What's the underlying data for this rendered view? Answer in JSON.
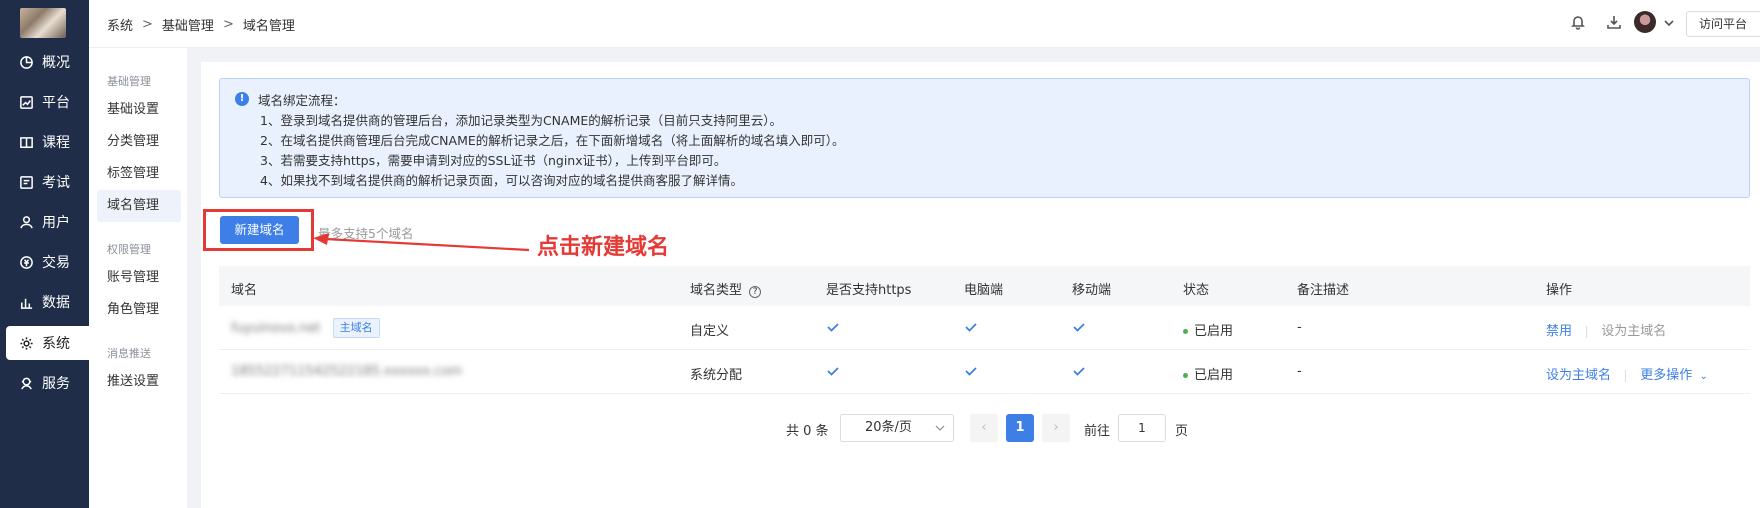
{
  "sidebar": {
    "items": [
      {
        "label": "概况",
        "icon": "overview-icon"
      },
      {
        "label": "平台",
        "icon": "platform-icon"
      },
      {
        "label": "课程",
        "icon": "course-icon"
      },
      {
        "label": "考试",
        "icon": "exam-icon"
      },
      {
        "label": "用户",
        "icon": "user-icon"
      },
      {
        "label": "交易",
        "icon": "trade-icon"
      },
      {
        "label": "数据",
        "icon": "data-icon"
      },
      {
        "label": "系统",
        "icon": "system-icon"
      },
      {
        "label": "服务",
        "icon": "service-icon"
      }
    ],
    "active": "系统"
  },
  "subnav": {
    "groups": [
      {
        "title": "基础管理",
        "items": [
          "基础设置",
          "分类管理",
          "标签管理",
          "域名管理"
        ]
      },
      {
        "title": "权限管理",
        "items": [
          "账号管理",
          "角色管理"
        ]
      },
      {
        "title": "消息推送",
        "items": [
          "推送设置"
        ]
      }
    ],
    "active": "域名管理"
  },
  "breadcrumb": [
    "系统",
    "基础管理",
    "域名管理"
  ],
  "header": {
    "visit_button": "访问平台"
  },
  "alert": {
    "title": "域名绑定流程：",
    "lines": [
      "1、登录到域名提供商的管理后台，添加记录类型为CNAME的解析记录（目前只支持阿里云）。",
      "2、在域名提供商管理后台完成CNAME的解析记录之后，在下面新增域名（将上面解析的域名填入即可）。",
      "3、若需要支持https，需要申请到对应的SSL证书（nginx证书），上传到平台即可。",
      "4、如果找不到域名提供商的解析记录页面，可以咨询对应的域名提供商客服了解详情。"
    ]
  },
  "toolbar": {
    "new_button": "新建域名",
    "limit_text": "最多支持5个域名",
    "annotation": "点击新建域名"
  },
  "table": {
    "columns": [
      "域名",
      "域名类型",
      "是否支持https",
      "电脑端",
      "移动端",
      "状态",
      "备注描述",
      "操作"
    ],
    "rows": [
      {
        "domain": "fuyuinovo.net",
        "tag": "主域名",
        "type": "自定义",
        "https": true,
        "pc": true,
        "mobile": true,
        "status": "已启用",
        "remark": "-",
        "actions": [
          "禁用",
          "设为主域名"
        ]
      },
      {
        "domain": "185522711542522185.xxxxxx.com",
        "tag": "",
        "type": "系统分配",
        "https": true,
        "pc": true,
        "mobile": true,
        "status": "已启用",
        "remark": "-",
        "actions": [
          "设为主域名",
          "更多操作"
        ]
      }
    ]
  },
  "pagination": {
    "total_text": "共 0 条",
    "page_size": "20条/页",
    "current_page": "1",
    "goto_label": "前往",
    "goto_value": "1",
    "page_suffix": "页"
  },
  "colors": {
    "sidebar_bg": "#1f2d49",
    "primary": "#3d7fe6",
    "annotation_red": "#e53935",
    "status_green": "#4caf50"
  }
}
